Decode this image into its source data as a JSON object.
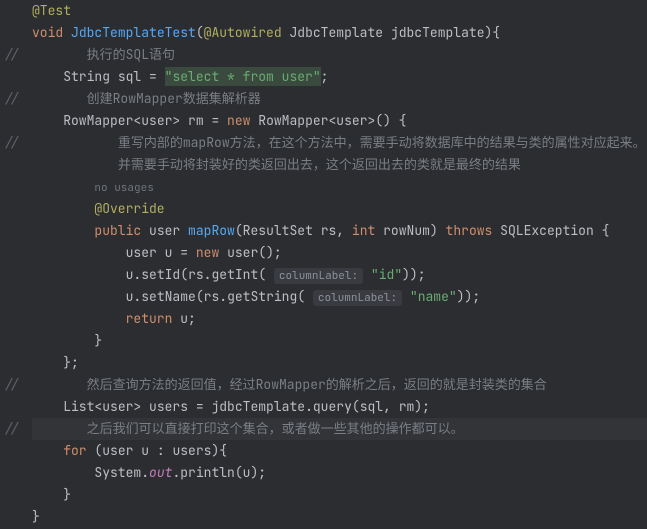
{
  "gutter_marks": [
    "",
    "",
    "//",
    "",
    "//",
    "",
    "//",
    "",
    "",
    "",
    "",
    "",
    "",
    "",
    "",
    "",
    "",
    "//",
    "",
    "//",
    "",
    "",
    "",
    ""
  ],
  "annotations": {
    "test": "@Test",
    "autowired": "@Autowired",
    "override": "@Override"
  },
  "keywords": {
    "void": "void",
    "new": "new",
    "public": "public",
    "int": "int",
    "throws": "throws",
    "return": "return",
    "for": "for"
  },
  "types": {
    "string": "String",
    "jdbc_template": "JdbcTemplate",
    "row_mapper": "RowMapper",
    "user": "user",
    "result_set": "ResultSet",
    "sql_exception": "SQLException",
    "list": "List",
    "system": "System"
  },
  "method_names": {
    "test_method": "JdbcTemplateTest",
    "map_row": "mapRow"
  },
  "comments": {
    "c1": "执行的SQL语句",
    "c2": "创建RowMapper数据集解析器",
    "c3": "重写内部的mapRow方法，在这个方法中，需要手动将数据库中的结果与类的属性对应起来。",
    "c4": "并需要手动将封装好的类返回出去，这个返回出去的类就是最终的结果",
    "c5": "然后查询方法的返回值，经过RowMapper的解析之后，返回的就是封装类的集合",
    "c6": "之后我们可以直接打印这个集合，或者做一些其他的操作都可以。"
  },
  "hints": {
    "no_usages": "no usages"
  },
  "strings": {
    "sql_query": "\"select * from user\"",
    "id": "\"id\"",
    "name": "\"name\""
  },
  "param_labels": {
    "column_label": "columnLabel:"
  },
  "vars": {
    "sql": "sql",
    "rm": "rm",
    "jdbc_template": "jdbcTemplate",
    "rs": "rs",
    "row_num": "rowNum",
    "u": "u",
    "users": "users",
    "out": "out"
  },
  "methods": {
    "set_id": "setId",
    "get_int": "getInt",
    "set_name": "setName",
    "get_string": "getString",
    "query": "query",
    "println": "println"
  }
}
